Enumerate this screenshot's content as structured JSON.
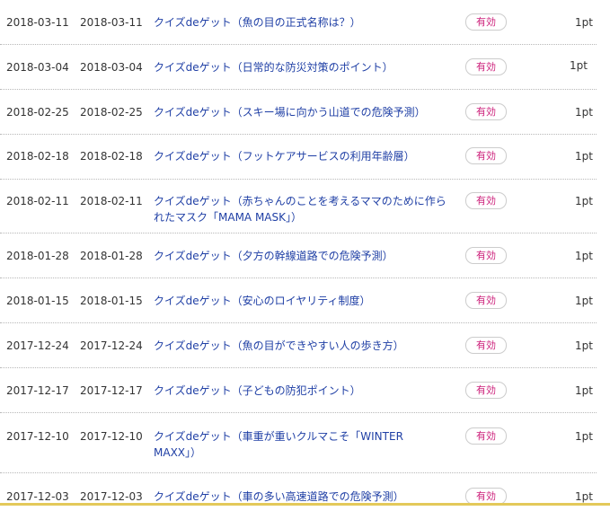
{
  "history": {
    "rows": [
      {
        "date1": "2018-03-11",
        "date2": "2018-03-11",
        "title": "クイズdeゲット（魚の目の正式名称は？）",
        "status": "有効",
        "points": "1pt"
      },
      {
        "date1": "2018-03-04",
        "date2": "2018-03-04",
        "title": "クイズdeゲット（日常的な防災対策のポイント）",
        "status": "有効",
        "points": "1pt"
      },
      {
        "date1": "2018-02-25",
        "date2": "2018-02-25",
        "title": "クイズdeゲット（スキー場に向かう山道での危険予測）",
        "status": "有効",
        "points": "1pt"
      },
      {
        "date1": "2018-02-18",
        "date2": "2018-02-18",
        "title": "クイズdeゲット（フットケアサービスの利用年齢層）",
        "status": "有効",
        "points": "1pt"
      },
      {
        "date1": "2018-02-11",
        "date2": "2018-02-11",
        "title": "クイズdeゲット（赤ちゃんのことを考えるママのために作られたマスク「MAMA MASK」）",
        "status": "有効",
        "points": "1pt"
      },
      {
        "date1": "2018-01-28",
        "date2": "2018-01-28",
        "title": "クイズdeゲット（夕方の幹線道路での危険予測）",
        "status": "有効",
        "points": "1pt"
      },
      {
        "date1": "2018-01-15",
        "date2": "2018-01-15",
        "title": "クイズdeゲット（安心のロイヤリティ制度）",
        "status": "有効",
        "points": "1pt"
      },
      {
        "date1": "2017-12-24",
        "date2": "2017-12-24",
        "title": "クイズdeゲット（魚の目ができやすい人の歩き方）",
        "status": "有効",
        "points": "1pt"
      },
      {
        "date1": "2017-12-17",
        "date2": "2017-12-17",
        "title": "クイズdeゲット（子どもの防犯ポイント）",
        "status": "有効",
        "points": "1pt"
      },
      {
        "date1": "2017-12-10",
        "date2": "2017-12-10",
        "title": "クイズdeゲット（車重が重いクルマこそ「WINTER MAXX」）",
        "status": "有効",
        "points": "1pt"
      },
      {
        "date1": "2017-12-03",
        "date2": "2017-12-03",
        "title": "クイズdeゲット（車の多い高速道路での危険予測）",
        "status": "有効",
        "points": "1pt"
      }
    ]
  }
}
